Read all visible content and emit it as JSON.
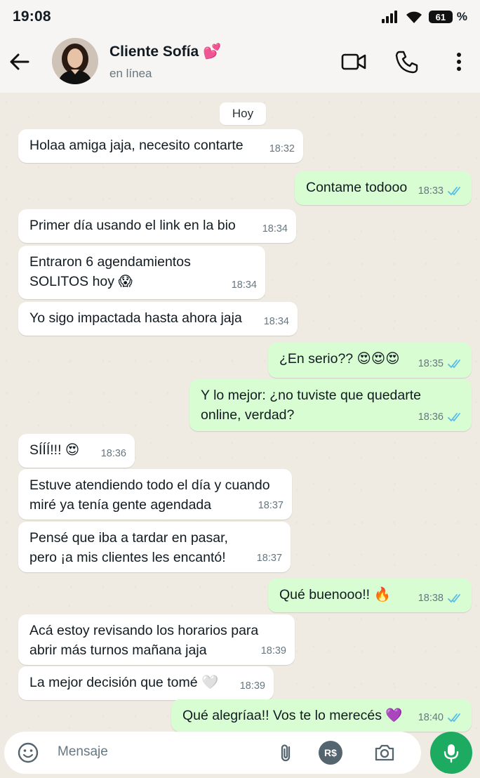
{
  "status_bar": {
    "time": "19:08",
    "battery": "61",
    "battery_suffix": "%"
  },
  "header": {
    "contact_name": "Cliente Sofía 💕",
    "contact_status": "en línea",
    "icons": [
      "back-arrow-icon",
      "video-call-icon",
      "phone-icon",
      "more-vert-icon"
    ]
  },
  "chat": {
    "day_label": "Hoy",
    "messages": [
      {
        "dir": "in",
        "text": "Holaa amiga jaja, necesito contarte",
        "time": "18:32"
      },
      {
        "dir": "out",
        "text": "Contame todooo",
        "time": "18:33",
        "read": true
      },
      {
        "dir": "in",
        "text": "Primer día usando el link en la bio",
        "time": "18:34"
      },
      {
        "dir": "in",
        "text": "Entraron 6 agendamientos\nSOLITOS hoy 😱",
        "time": "18:34"
      },
      {
        "dir": "in",
        "text": "Yo sigo impactada hasta ahora jaja",
        "time": "18:34"
      },
      {
        "dir": "out",
        "text": "¿En serio?? 😍😍😍",
        "time": "18:35",
        "read": true
      },
      {
        "dir": "out",
        "text": "Y lo mejor: ¿no tuviste que quedarte\nonline, verdad?",
        "time": "18:36",
        "read": true
      },
      {
        "dir": "in",
        "text": "SÍÍÍ!!! 😍",
        "time": "18:36"
      },
      {
        "dir": "in",
        "text": "Estuve atendiendo todo el día y cuando\nmiré ya tenía gente agendada",
        "time": "18:37"
      },
      {
        "dir": "in",
        "text": "Pensé que iba a tardar en pasar,\npero ¡a mis clientes les encantó!",
        "time": "18:37"
      },
      {
        "dir": "out",
        "text": "Qué buenooo!! 🔥",
        "time": "18:38",
        "read": true
      },
      {
        "dir": "in",
        "text": "Acá estoy revisando los horarios para\nabrir más turnos mañana jaja",
        "time": "18:39"
      },
      {
        "dir": "in",
        "text": "La mejor decisión que tomé 🤍",
        "time": "18:39"
      },
      {
        "dir": "out",
        "text": "Qué alegríaa!! Vos te lo merecés 💜",
        "time": "18:40",
        "read": true
      }
    ]
  },
  "input": {
    "placeholder": "Mensaje",
    "payment_label": "R$",
    "icons": [
      "emoji-icon",
      "attach-icon",
      "payment-icon",
      "camera-icon",
      "mic-icon"
    ]
  },
  "colors": {
    "incoming": "#ffffff",
    "outgoing": "#d9fdd3",
    "tick_read": "#53bdeb",
    "accent": "#1daa61"
  }
}
